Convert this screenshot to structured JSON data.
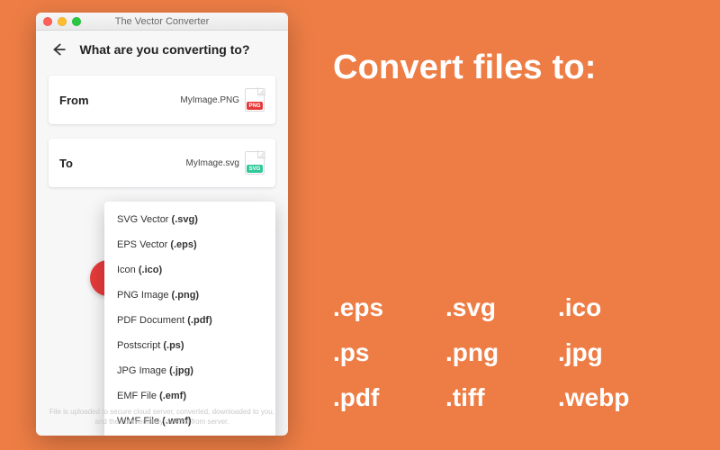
{
  "window": {
    "title": "The Vector Converter"
  },
  "page": {
    "title": "What are you converting to?",
    "footnote": "File is uploaded to secure cloud server, converted, downloaded to you, and then immediately deleted from server."
  },
  "from": {
    "label": "From",
    "filename": "MyImage.PNG",
    "badge": "PNG"
  },
  "to": {
    "label": "To",
    "filename": "MyImage.svg",
    "badge": "SVG"
  },
  "dropdown": {
    "items": [
      {
        "name": "SVG Vector",
        "ext": "(.svg)"
      },
      {
        "name": "EPS Vector",
        "ext": "(.eps)"
      },
      {
        "name": "Icon",
        "ext": "(.ico)"
      },
      {
        "name": "PNG Image",
        "ext": "(.png)"
      },
      {
        "name": "PDF Document",
        "ext": "(.pdf)"
      },
      {
        "name": "Postscript",
        "ext": "(.ps)"
      },
      {
        "name": "JPG Image",
        "ext": "(.jpg)"
      },
      {
        "name": "EMF File",
        "ext": "(.emf)"
      },
      {
        "name": "WMF File",
        "ext": "(.wmf)"
      }
    ]
  },
  "hero": {
    "title": "Convert files to:"
  },
  "extensions": [
    ".eps",
    ".svg",
    ".ico",
    ".ps",
    ".png",
    ".jpg",
    ".pdf",
    ".tiff",
    ".webp"
  ]
}
